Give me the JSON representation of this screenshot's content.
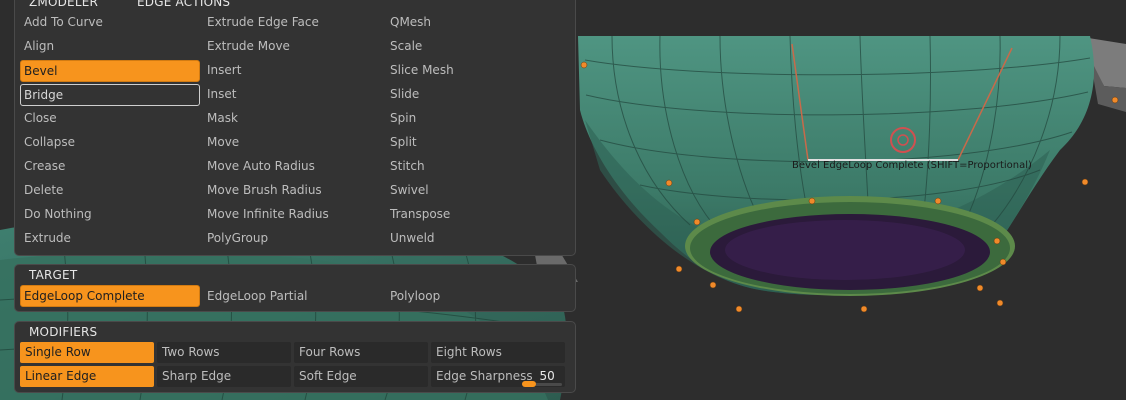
{
  "zmodeler_panel": {
    "title": "ZMODELER",
    "subtitle": "EDGE ACTIONS",
    "columns": [
      [
        "Add To Curve",
        "Align",
        "Bevel",
        "Bridge",
        "Close",
        "Collapse",
        "Crease",
        "Delete",
        "Do Nothing",
        "Extrude"
      ],
      [
        "Extrude Edge Face",
        "Extrude Move",
        "Insert",
        "Inset",
        "Mask",
        "Move",
        "Move Auto Radius",
        "Move Brush Radius",
        "Move Infinite Radius",
        "PolyGroup"
      ],
      [
        "QMesh",
        "Scale",
        "Slice Mesh",
        "Slide",
        "Spin",
        "Split",
        "Stitch",
        "Swivel",
        "Transpose",
        "Unweld"
      ]
    ],
    "active_action": "Bevel",
    "hovered_action": "Bridge"
  },
  "target_panel": {
    "title": "TARGET",
    "items": [
      "EdgeLoop Complete",
      "EdgeLoop Partial",
      "Polyloop"
    ],
    "active": "EdgeLoop Complete"
  },
  "modifiers_panel": {
    "title": "MODIFIERS",
    "row1": [
      "Single Row",
      "Two Rows",
      "Four Rows",
      "Eight Rows"
    ],
    "row2": [
      "Linear Edge",
      "Sharp Edge",
      "Soft Edge"
    ],
    "active": [
      "Single Row",
      "Linear Edge"
    ],
    "edge_sharpness_label": "Edge Sharpness",
    "edge_sharpness_value": "50",
    "edge_sharpness_fraction": 0.5
  },
  "viewport": {
    "tooltip": "Bevel EdgeLoop Complete (SHIFT=Proportional)"
  },
  "colors": {
    "accent": "#f7941d",
    "mesh": "#3f7f6c",
    "panel_bg": "#333333"
  }
}
